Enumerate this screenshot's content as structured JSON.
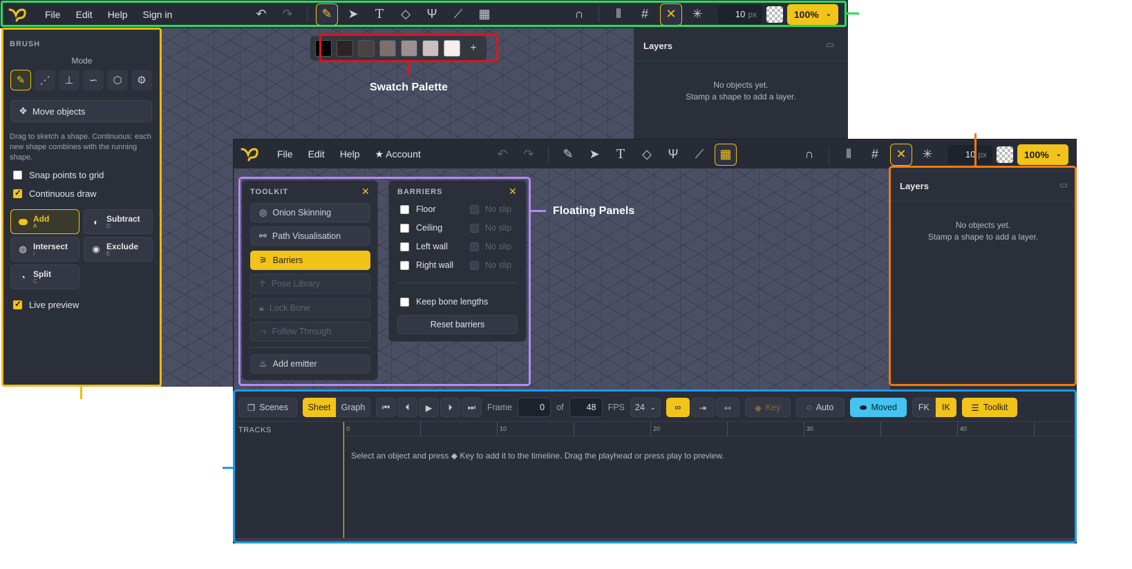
{
  "back_window": {
    "menu": [
      "File",
      "Edit",
      "Help",
      "Sign in"
    ],
    "px_value": "10",
    "px_unit": "px",
    "zoom": "100%",
    "brush": {
      "title": "BRUSH",
      "mode_label": "Mode",
      "move_objects": "Move objects",
      "hint": "Drag to sketch a shape. Continuous: each new shape combines with the running shape.",
      "snap": "Snap points to grid",
      "continuous": "Continuous draw",
      "ops": [
        {
          "label": "Add",
          "key": "A"
        },
        {
          "label": "Subtract",
          "key": "D"
        },
        {
          "label": "Intersect",
          "key": "I"
        },
        {
          "label": "Exclude",
          "key": "E"
        },
        {
          "label": "Split",
          "key": "C"
        }
      ],
      "live_preview": "Live preview"
    },
    "swatches": [
      "#050505",
      "#2c2324",
      "#4a4143",
      "#7b6f70",
      "#9d9091",
      "#c9c0bf",
      "#f5eeee"
    ],
    "swatch_add": "+",
    "layers": {
      "title": "Layers",
      "msg1": "No objects yet.",
      "msg2": "Stamp a shape to add a layer."
    }
  },
  "front_window": {
    "menu": [
      "File",
      "Edit",
      "Help",
      "Account"
    ],
    "px_value": "10",
    "px_unit": "px",
    "zoom": "100%",
    "toolkit": {
      "title": "TOOLKIT",
      "items": [
        "Onion Skinning",
        "Path Visualisation",
        "Barriers",
        "Pose Library",
        "Lock Bone",
        "Follow Through"
      ],
      "add_emitter": "Add emitter"
    },
    "barriers": {
      "title": "BARRIERS",
      "rows": [
        "Floor",
        "Ceiling",
        "Left wall",
        "Right wall"
      ],
      "no_slip": "No slip",
      "keep_bone": "Keep bone lengths",
      "reset": "Reset barriers"
    },
    "layers": {
      "title": "Layers",
      "msg1": "No objects yet.",
      "msg2": "Stamp a shape to add a layer."
    },
    "timeline": {
      "scenes": "Scenes",
      "sheet": "Sheet",
      "graph": "Graph",
      "frame_label": "Frame",
      "frame_value": "0",
      "of_label": "of",
      "total_frames": "48",
      "fps_label": "FPS",
      "fps_value": "24",
      "key": "Key",
      "auto": "Auto",
      "moved": "Moved",
      "fk": "FK",
      "ik": "IK",
      "toolkit": "Toolkit",
      "tracks": "TRACKS",
      "ticks": [
        "0",
        "10",
        "20",
        "30",
        "40"
      ],
      "hint": "Select an object and press ◆ Key to add it to the timeline. Drag the playhead or press play to preview."
    }
  },
  "callouts": {
    "swatch": "Swatch Palette",
    "floating": "Floating Panels"
  },
  "colors": {
    "accent": "#f2c318",
    "green": "#22e05a",
    "red": "#e0141b",
    "orange": "#f07a10",
    "purple": "#b78af5",
    "blue": "#1a9cf0",
    "yellow_outline": "#f7b70e"
  }
}
